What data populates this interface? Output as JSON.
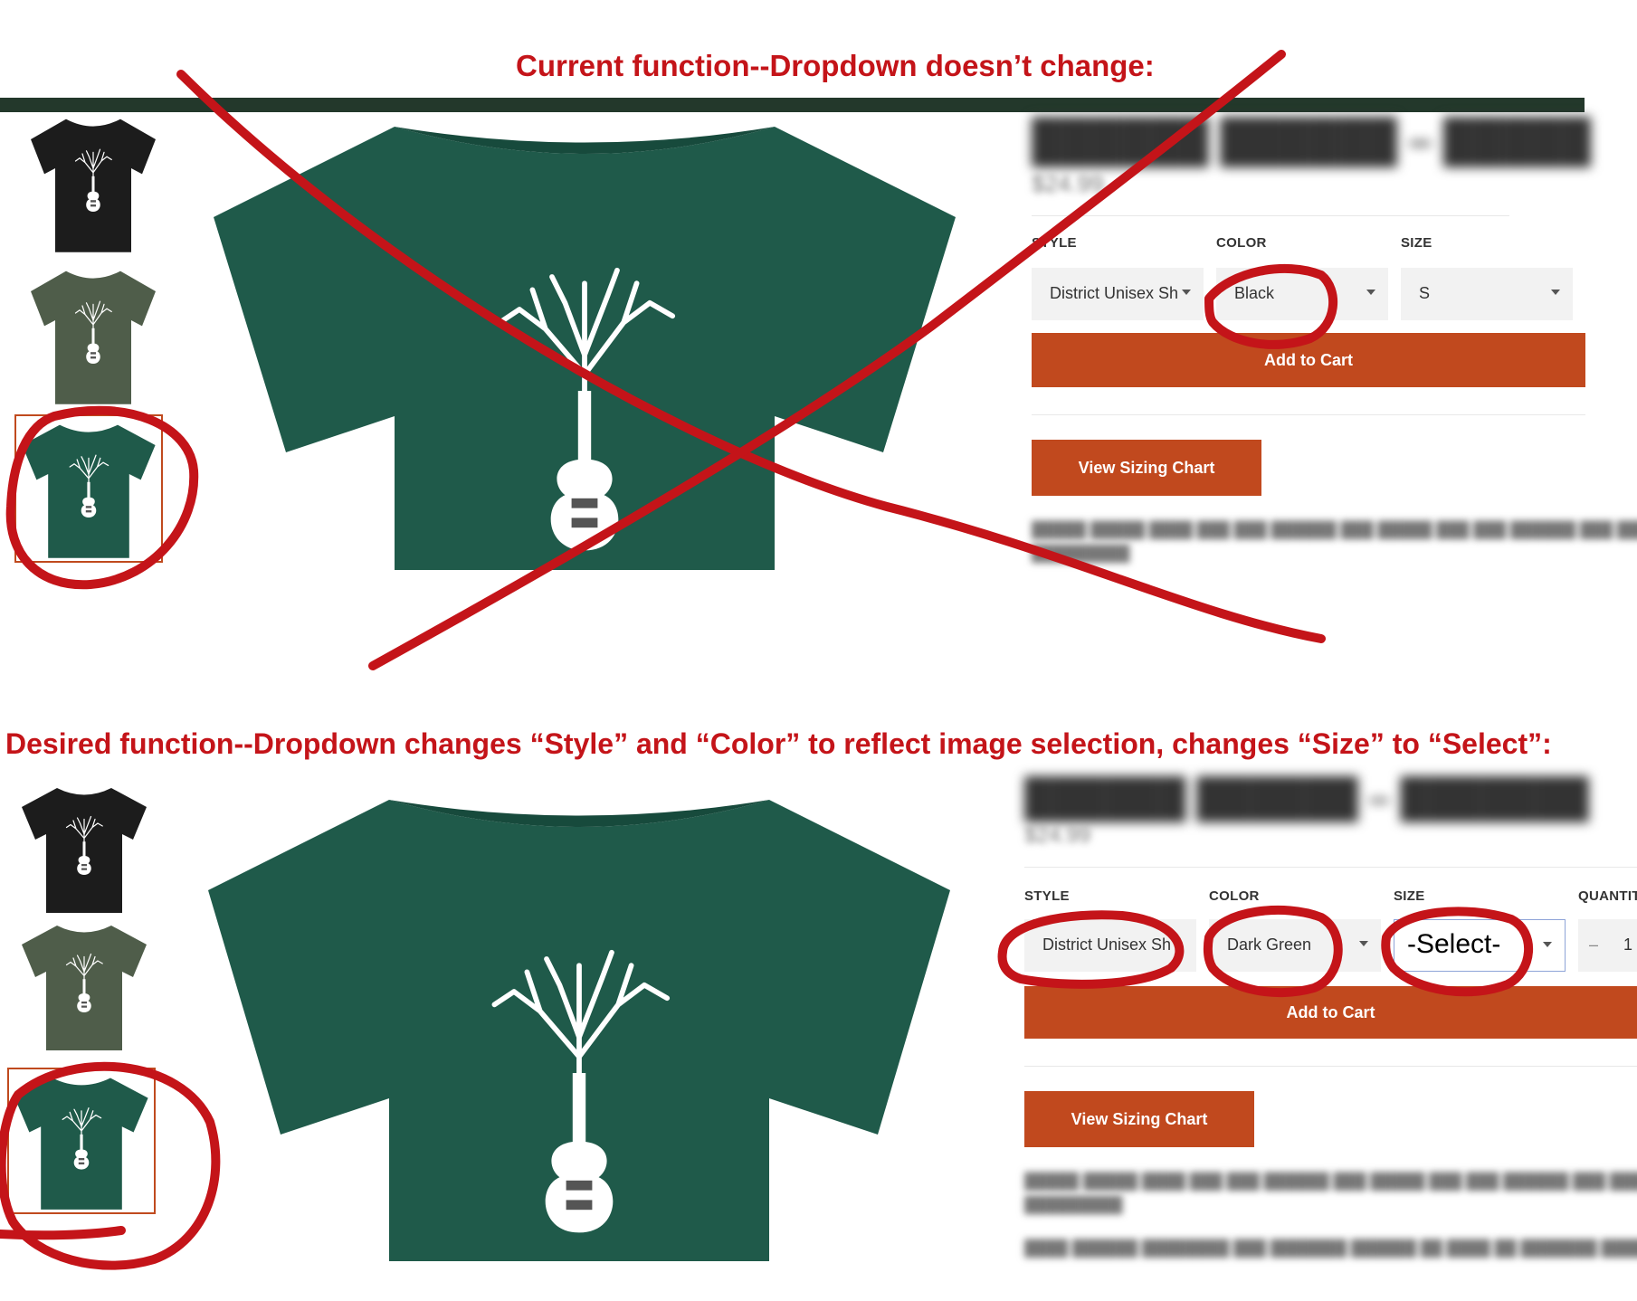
{
  "annotations": {
    "top_heading": "Current function--Dropdown doesn’t change:",
    "bottom_heading": "Desired function--Dropdown changes “Style” and “Color” to reflect image selection, changes “Size” to  “Select”:"
  },
  "colors": {
    "annotation_red": "#c41419",
    "button_orange": "#c1491e",
    "header_bar": "#23382b",
    "shirt_black": "#1c1c1c",
    "shirt_olive": "#4f5d4a",
    "shirt_dark_green": "#1f5a4a"
  },
  "current": {
    "thumbnails": [
      {
        "color_name": "black",
        "selected": false
      },
      {
        "color_name": "olive",
        "selected": false
      },
      {
        "color_name": "dark-green",
        "selected": true
      }
    ],
    "labels": {
      "style": "STYLE",
      "color": "COLOR",
      "size": "SIZE"
    },
    "style_value": "District Unisex Sh",
    "color_value": "Black",
    "size_value": "S",
    "add_to_cart": "Add to Cart",
    "sizing_chart": "View Sizing Chart"
  },
  "desired": {
    "thumbnails": [
      {
        "color_name": "black",
        "selected": false
      },
      {
        "color_name": "olive",
        "selected": false
      },
      {
        "color_name": "dark-green",
        "selected": true
      }
    ],
    "labels": {
      "style": "STYLE",
      "color": "COLOR",
      "size": "SIZE",
      "quantity": "QUANTIT"
    },
    "style_value": "District Unisex Sh",
    "color_value": "Dark Green",
    "size_value": "-Select-",
    "quantity_value": "1",
    "quantity_minus": "–",
    "price": "$24.99",
    "add_to_cart": "Add to Cart",
    "sizing_chart": "View Sizing Chart"
  }
}
